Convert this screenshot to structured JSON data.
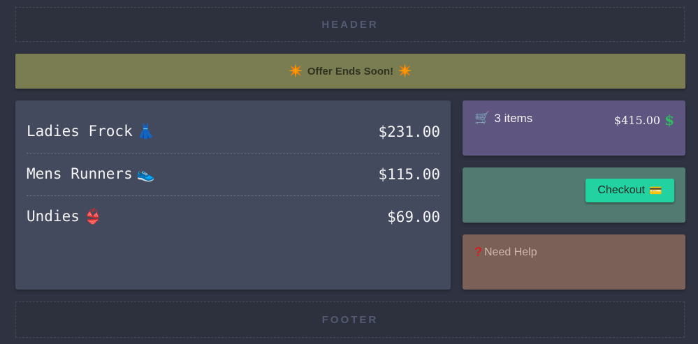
{
  "header": {
    "label": "HEADER"
  },
  "banner": {
    "text": "Offer Ends Soon!",
    "left_icon": "sparkle-star",
    "right_icon": "sparkle-star"
  },
  "cart": {
    "items": [
      {
        "name": "Ladies Frock",
        "emoji": "👗",
        "icon": "dress-icon",
        "price": "$231.00"
      },
      {
        "name": "Mens Runners",
        "emoji": "👟",
        "icon": "sneaker-icon",
        "price": "$115.00"
      },
      {
        "name": "Undies",
        "emoji": "👙",
        "icon": "bikini-icon",
        "price": "$69.00"
      }
    ]
  },
  "summary": {
    "count_label": "3 items",
    "total": "$415.00",
    "cart_icon": "shopping-cart-icon",
    "money_icon": "dollar-icon"
  },
  "checkout": {
    "label": "Checkout",
    "icon": "credit-card-icon"
  },
  "help": {
    "label": "Need Help",
    "icon": "question-mark-icon"
  },
  "footer": {
    "label": "FOOTER"
  },
  "colors": {
    "background": "#2f3240",
    "banner": "#7a7d52",
    "cart_panel": "#444a5e",
    "summary_panel": "#5e5581",
    "checkout_panel": "#527a70",
    "help_panel": "#7a6057",
    "checkout_button": "#22d3a1"
  }
}
